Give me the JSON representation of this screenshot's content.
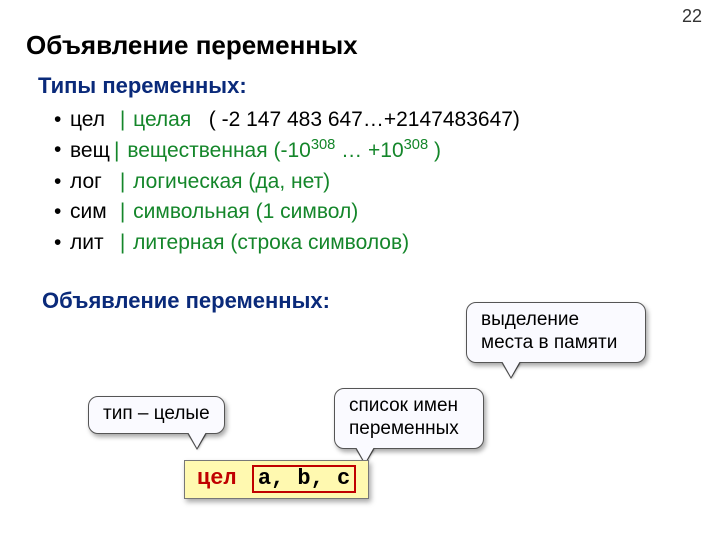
{
  "page": {
    "number": "22",
    "title": "Объявление переменных"
  },
  "types_heading": "Типы переменных:",
  "types": [
    {
      "kw": "цел",
      "desc": "целая",
      "range": "( -2 147 483 647…+2147483647)"
    },
    {
      "kw": "вещ",
      "desc": "вещественная",
      "range_pre": "(-10",
      "exp1": "308",
      "range_mid": " … +10",
      "exp2": "308",
      "range_post": " )"
    },
    {
      "kw": "лог",
      "desc": "логическая",
      "range": "(да, нет)"
    },
    {
      "kw": "сим",
      "desc": "символьная",
      "range": "(1 символ)"
    },
    {
      "kw": "лит",
      "desc": "литерная",
      "range": "(строка символов)"
    }
  ],
  "decl_heading": "Объявление переменных:",
  "callouts": {
    "type_int": "тип – целые",
    "var_list": "список имен переменных",
    "mem_alloc": "выделение места в памяти"
  },
  "code": {
    "kw": "цел",
    "vars": "a, b, c"
  },
  "sep": "|"
}
